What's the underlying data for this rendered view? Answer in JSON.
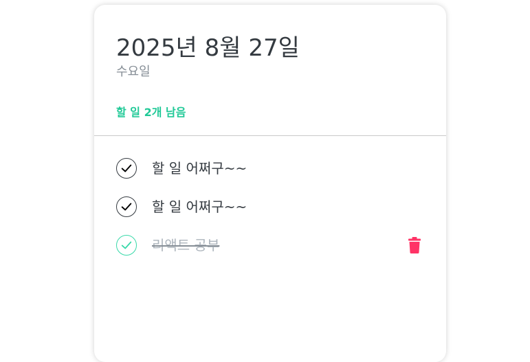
{
  "header": {
    "date": "2025년 8월 27일",
    "weekday": "수요일",
    "tasks_left": "할 일 2개 남음"
  },
  "todos": [
    {
      "text": "할 일 어쩌구~~",
      "done": false
    },
    {
      "text": "할 일 어쩌구~~",
      "done": false
    },
    {
      "text": "리액트 공부",
      "done": true
    }
  ],
  "icons": {
    "check": "check-icon",
    "trash": "trash-icon"
  },
  "colors": {
    "accent": "#20c997",
    "done_check": "#38d9a9",
    "delete": "#ff3366",
    "text": "#343a40",
    "muted": "#868e96"
  }
}
